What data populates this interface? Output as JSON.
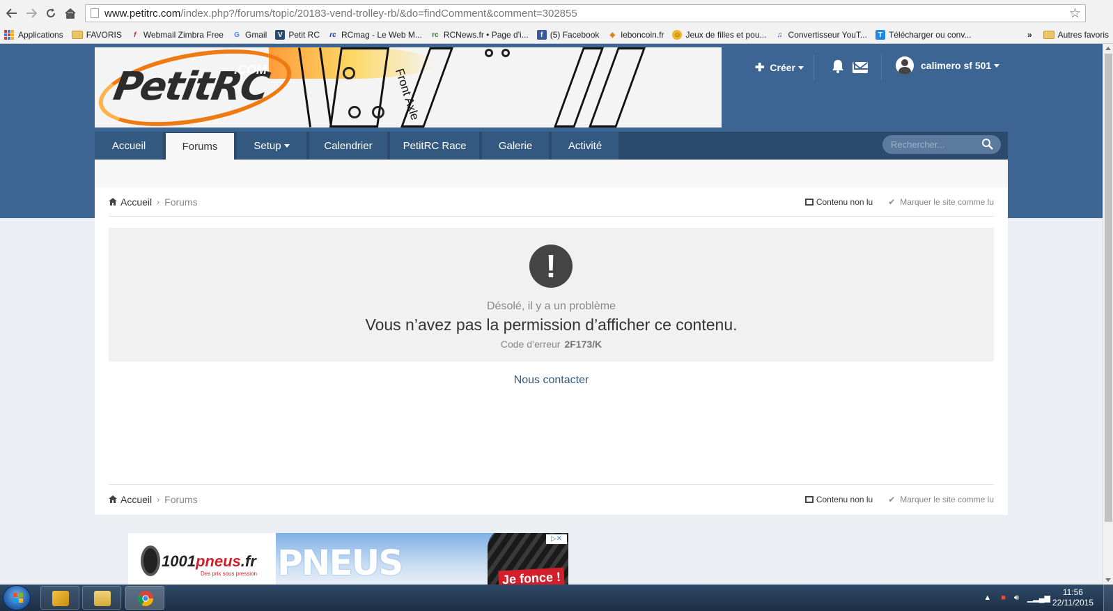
{
  "browser": {
    "url_host": "www.petitrc.com",
    "url_path": "/index.php?/forums/topic/20183-vend-trolley-rb/&do=findComment&comment=302855",
    "bookmarks": [
      {
        "label": "Applications",
        "icon": "apps-icon"
      },
      {
        "label": "FAVORIS",
        "icon": "folder-icon"
      },
      {
        "label": "Webmail Zimbra Free",
        "icon": "zimbra-icon"
      },
      {
        "label": "Gmail",
        "icon": "google-icon"
      },
      {
        "label": "Petit RC",
        "icon": "petitrc-icon"
      },
      {
        "label": "RCmag - Le Web M...",
        "icon": "rcmag-icon"
      },
      {
        "label": "RCNews.fr • Page d'i...",
        "icon": "rcnews-icon"
      },
      {
        "label": "(5) Facebook",
        "icon": "facebook-icon"
      },
      {
        "label": "leboncoin.fr",
        "icon": "leboncoin-icon"
      },
      {
        "label": "Jeux de filles et pou...",
        "icon": "jeux-icon"
      },
      {
        "label": "Convertisseur YouT...",
        "icon": "mp3-icon"
      },
      {
        "label": "Télécharger ou conv...",
        "icon": "telecharger-icon"
      }
    ],
    "overflow_label": "»",
    "other_bookmarks": "Autres favoris"
  },
  "site": {
    "banner": {
      "logo_text": "PetitRC",
      "logo_com": ".COM",
      "sketch_text": "Front Axle"
    },
    "header": {
      "create_label": "Créer",
      "username": "calimero sf 501"
    },
    "nav": {
      "tabs": [
        {
          "label": "Accueil",
          "active": false
        },
        {
          "label": "Forums",
          "active": true
        },
        {
          "label": "Setup",
          "active": false,
          "dropdown": true
        },
        {
          "label": "Calendrier",
          "active": false
        },
        {
          "label": "PetitRC Race",
          "active": false
        },
        {
          "label": "Galerie",
          "active": false
        },
        {
          "label": "Activité",
          "active": false
        }
      ],
      "search_placeholder": "Rechercher..."
    },
    "breadcrumb": {
      "home": "Accueil",
      "current": "Forums",
      "unread": "Contenu non lu",
      "mark_read": "Marquer le site comme lu"
    },
    "error": {
      "sorry": "Désolé, il y a un problème",
      "message": "Vous n’avez pas la permission d’afficher ce contenu.",
      "code_label": "Code d’erreur",
      "code_value": "2F173/K",
      "contact": "Nous contacter"
    },
    "ad": {
      "brand_black": "1001",
      "brand_red": "pneus",
      "brand_suffix": ".fr",
      "tagline": "Des prix sous pression",
      "headline": "PNEUS",
      "cta": "Je fonce !",
      "adchoices": "▷✕"
    }
  },
  "taskbar": {
    "time": "11:56",
    "date": "22/11/2015"
  },
  "colors": {
    "site_blue": "#3d6594",
    "nav_dark": "#2c4a6e",
    "link_blue": "#34597f"
  }
}
